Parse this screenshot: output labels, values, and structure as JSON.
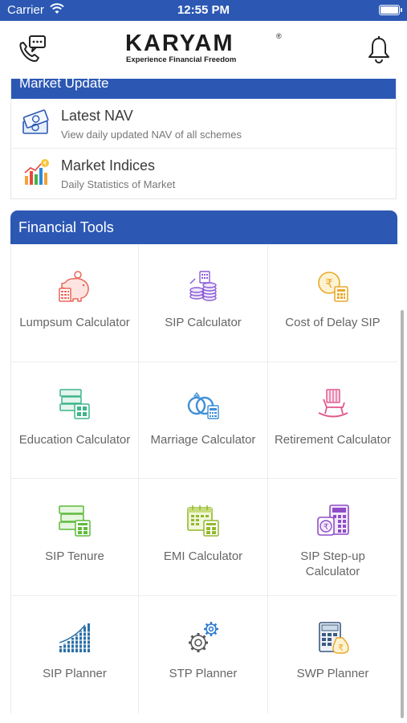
{
  "status_bar": {
    "carrier": "Carrier",
    "time": "12:55 PM"
  },
  "header": {
    "logo_text": "KARYAM",
    "logo_reg": "®",
    "tagline": "Experience Financial Freedom",
    "left_icon": "phone-chat-icon",
    "right_icon": "bell-icon"
  },
  "market_update": {
    "title": "Market Update",
    "items": [
      {
        "title": "Latest NAV",
        "subtitle": "View daily updated NAV of all schemes",
        "icon": "cash-icon"
      },
      {
        "title": "Market Indices",
        "subtitle": "Daily Statistics of Market",
        "icon": "bar-chart-icon"
      }
    ]
  },
  "financial_tools": {
    "title": "Financial Tools",
    "items": [
      {
        "label": "Lumpsum Calculator",
        "icon": "piggy-bank-icon"
      },
      {
        "label": "SIP Calculator",
        "icon": "coins-stack-icon"
      },
      {
        "label": "Cost of Delay SIP",
        "icon": "rupee-coin-calculator-icon"
      },
      {
        "label": "Education Calculator",
        "icon": "books-calculator-icon"
      },
      {
        "label": "Marriage Calculator",
        "icon": "rings-calculator-icon"
      },
      {
        "label": "Retirement Calculator",
        "icon": "rocking-chair-icon"
      },
      {
        "label": "SIP Tenure",
        "icon": "book-calculator-icon"
      },
      {
        "label": "EMI Calculator",
        "icon": "calendar-calculator-icon"
      },
      {
        "label": "SIP Step-up Calculator",
        "icon": "wallet-calculator-icon"
      },
      {
        "label": "SIP Planner",
        "icon": "growth-bars-icon"
      },
      {
        "label": "STP Planner",
        "icon": "gears-icon"
      },
      {
        "label": "SWP Planner",
        "icon": "calculator-rupee-icon"
      }
    ]
  },
  "colors": {
    "brand_blue": "#2c58b4"
  }
}
